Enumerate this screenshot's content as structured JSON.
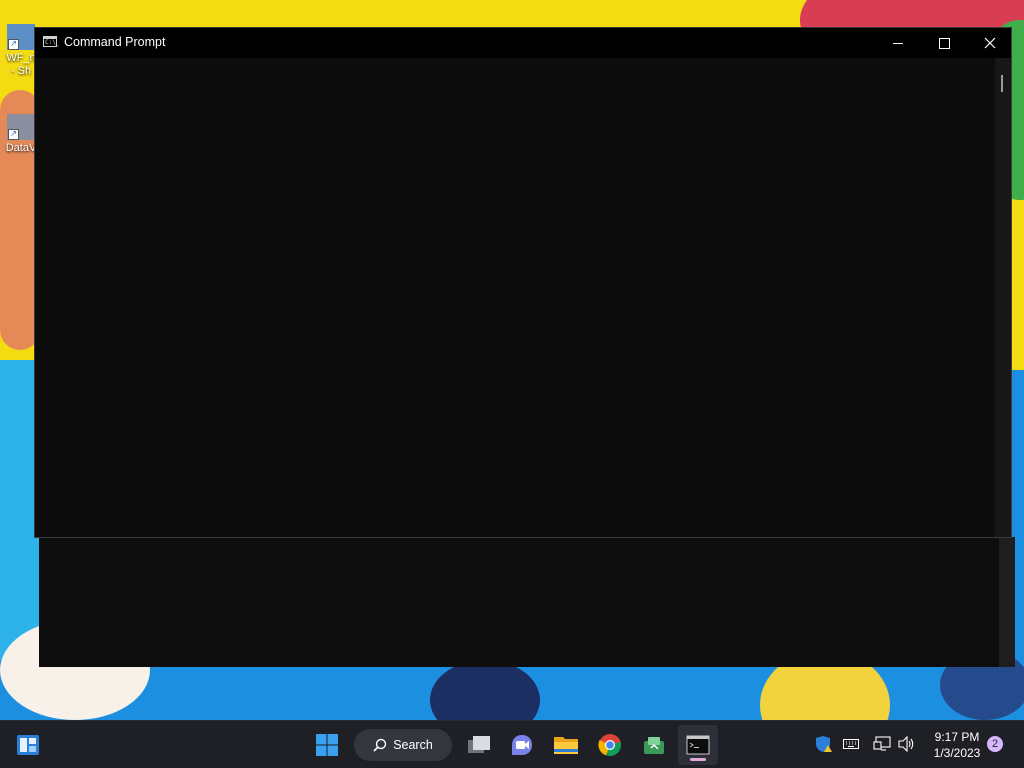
{
  "desktop": {
    "icons": [
      {
        "label": "WF_n\n- Sh",
        "icon": "shortcut-icon"
      },
      {
        "label": "DataV",
        "icon": "shortcut-icon"
      }
    ]
  },
  "window": {
    "title": "Command Prompt",
    "icon": "cmd-icon",
    "icon_glyph": "C:\\_",
    "controls": {
      "minimize": "minimize-icon",
      "maximize": "maximize-icon",
      "close": "close-icon"
    },
    "console_text": ""
  },
  "taskbar": {
    "search_label": "Search",
    "apps": [
      {
        "name": "widgets",
        "icon": "widgets-icon"
      },
      {
        "name": "start",
        "icon": "windows-logo-icon"
      },
      {
        "name": "task-view",
        "icon": "task-view-icon"
      },
      {
        "name": "teams-chat",
        "icon": "teams-chat-icon"
      },
      {
        "name": "file-explorer",
        "icon": "folder-icon"
      },
      {
        "name": "chrome",
        "icon": "chrome-icon"
      },
      {
        "name": "store",
        "icon": "store-icon"
      },
      {
        "name": "command-prompt",
        "icon": "terminal-icon",
        "active": true
      }
    ],
    "tray": {
      "time": "9:17 PM",
      "date": "1/3/2023",
      "notification_count": "2",
      "icons": [
        "defender-warning-icon",
        "keyboard-icon",
        "network-icon",
        "volume-icon"
      ]
    }
  },
  "colors": {
    "console_bg": "#0c0c0c",
    "titlebar_bg": "#000000",
    "taskbar_bg": "#1e2026",
    "accent": "#0078d4",
    "wallpaper_yellow": "#f3dc12",
    "wallpaper_blue": "#1d8fe0"
  }
}
